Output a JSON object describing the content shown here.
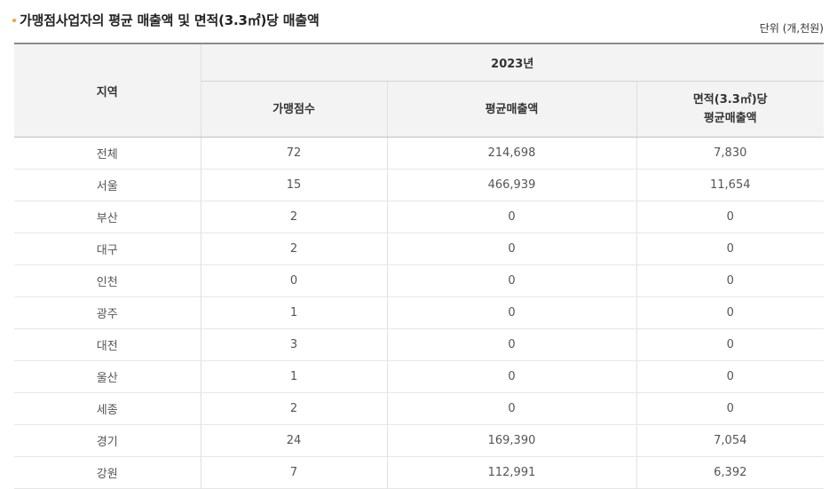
{
  "header": {
    "title": "가맹점사업자의 평균 매출액 및 면적(3.3㎡)당 매출액",
    "unit": "단위 (개,천원)"
  },
  "table": {
    "region_header": "지역",
    "year_header": "2023년",
    "columns": [
      "가맹점수",
      "평균매출액"
    ],
    "col3_line1": "면적(3.3㎡)당",
    "col3_line2": "평균매출액",
    "rows": [
      {
        "region": "전체",
        "stores": "72",
        "avg_sales": "214,698",
        "per_area": "7,830"
      },
      {
        "region": "서울",
        "stores": "15",
        "avg_sales": "466,939",
        "per_area": "11,654"
      },
      {
        "region": "부산",
        "stores": "2",
        "avg_sales": "0",
        "per_area": "0"
      },
      {
        "region": "대구",
        "stores": "2",
        "avg_sales": "0",
        "per_area": "0"
      },
      {
        "region": "인천",
        "stores": "0",
        "avg_sales": "0",
        "per_area": "0"
      },
      {
        "region": "광주",
        "stores": "1",
        "avg_sales": "0",
        "per_area": "0"
      },
      {
        "region": "대전",
        "stores": "3",
        "avg_sales": "0",
        "per_area": "0"
      },
      {
        "region": "울산",
        "stores": "1",
        "avg_sales": "0",
        "per_area": "0"
      },
      {
        "region": "세종",
        "stores": "2",
        "avg_sales": "0",
        "per_area": "0"
      },
      {
        "region": "경기",
        "stores": "24",
        "avg_sales": "169,390",
        "per_area": "7,054"
      },
      {
        "region": "강원",
        "stores": "7",
        "avg_sales": "112,991",
        "per_area": "6,392"
      }
    ]
  }
}
